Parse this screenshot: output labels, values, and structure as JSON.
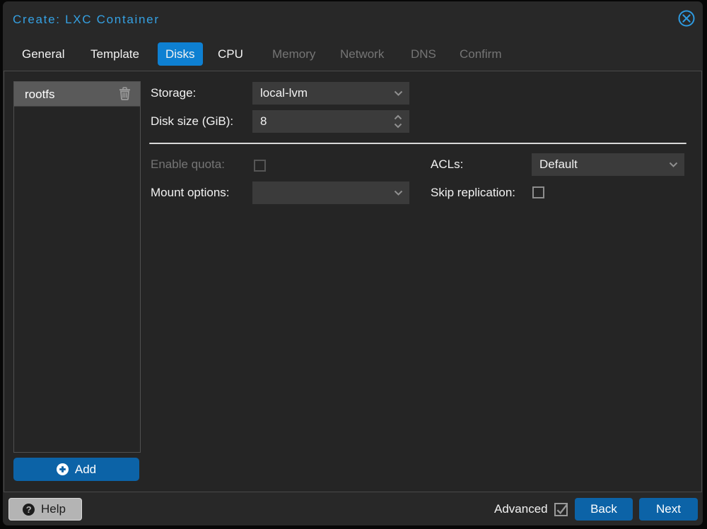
{
  "window": {
    "title": "Create: LXC Container"
  },
  "tabs": [
    {
      "label": "General",
      "state": "normal"
    },
    {
      "label": "Template",
      "state": "normal"
    },
    {
      "label": "Disks",
      "state": "active"
    },
    {
      "label": "CPU",
      "state": "normal"
    },
    {
      "label": "Memory",
      "state": "disabled"
    },
    {
      "label": "Network",
      "state": "disabled"
    },
    {
      "label": "DNS",
      "state": "disabled"
    },
    {
      "label": "Confirm",
      "state": "disabled"
    }
  ],
  "disk_list": {
    "items": [
      {
        "label": "rootfs",
        "selected": true
      }
    ],
    "add_button_label": "Add"
  },
  "form": {
    "storage": {
      "label": "Storage:",
      "value": "local-lvm",
      "type": "combobox"
    },
    "disk_size": {
      "label": "Disk size (GiB):",
      "value": "8",
      "type": "spinner"
    },
    "enable_quota": {
      "label": "Enable quota:",
      "checked": false,
      "disabled": true
    },
    "acls": {
      "label": "ACLs:",
      "value": "Default",
      "type": "combobox"
    },
    "mount_options": {
      "label": "Mount options:",
      "value": "",
      "type": "combobox"
    },
    "skip_replication": {
      "label": "Skip replication:",
      "checked": false,
      "disabled": false
    }
  },
  "footer": {
    "help_label": "Help",
    "advanced_label": "Advanced",
    "advanced_checked": true,
    "back_label": "Back",
    "next_label": "Next"
  },
  "colors": {
    "title_blue": "#35a1e3",
    "active_tab_blue": "#0e80d2",
    "button_blue": "#0c63a7",
    "window_background": "#282828",
    "content_background": "#252525",
    "field_background": "#3b3b3b",
    "selected_row_background": "#5a5a5a",
    "help_button_background": "#b4b4b4"
  }
}
